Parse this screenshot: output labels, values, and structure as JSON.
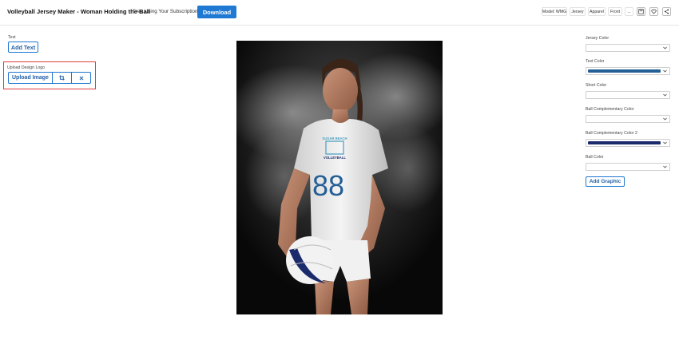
{
  "header": {
    "title": "Volleyball Jersey Maker - Woman Holding the Ball",
    "subscription_note": "Free Using Your Subscription!",
    "download_label": "Download",
    "filters": [
      "Model: WMG",
      "Jersey",
      "Apparel",
      "Front",
      "..."
    ],
    "icons": [
      "save-icon",
      "heart-icon",
      "share-icon"
    ]
  },
  "left_panel": {
    "text_label": "Text",
    "add_text_label": "Add Text",
    "logo_label": "Upload Design Logo",
    "upload_image_label": "Upload Image",
    "crop_icon": "crop-icon",
    "remove_icon": "close-icon"
  },
  "preview": {
    "jersey_number": "88",
    "logo_line_1": "SUGAR BEACH",
    "logo_line_2": "VOLLEYBALL"
  },
  "right_panel": {
    "fields": [
      {
        "label": "Jersey Color",
        "color": "#ffffff"
      },
      {
        "label": "Text Color",
        "color": "#245f96"
      },
      {
        "label": "Short Color",
        "color": "#ffffff"
      },
      {
        "label": "Ball Complementary Color",
        "color": "#ffffff"
      },
      {
        "label": "Ball Complementary Color 2",
        "color": "#1b2a6b"
      },
      {
        "label": "Ball Color",
        "color": "#ffffff"
      }
    ],
    "add_graphic_label": "Add Graphic"
  },
  "colors": {
    "accent": "#1f78d1",
    "highlight": "#e23b3b"
  }
}
